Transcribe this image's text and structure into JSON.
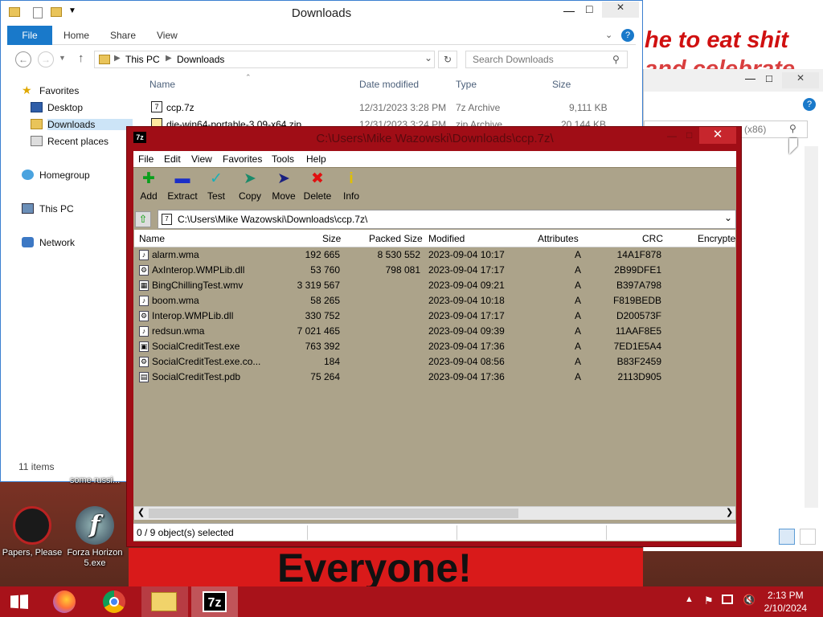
{
  "desktop": {
    "meme_top": [
      "he to eat shit",
      "and celebrate"
    ],
    "meme_bottom": "Everyone!",
    "icons": [
      {
        "label": "some russi..."
      },
      {
        "label": "Papers, Please"
      },
      {
        "label": "Forza Horizon 5.exe"
      }
    ]
  },
  "explorer": {
    "title": "Downloads",
    "tabs": [
      "File",
      "Home",
      "Share",
      "View"
    ],
    "address": [
      "This PC",
      "Downloads"
    ],
    "search_placeholder": "Search Downloads",
    "nav": [
      "Favorites",
      "Desktop",
      "Downloads",
      "Recent places",
      "Homegroup",
      "This PC",
      "Network"
    ],
    "columns": [
      "Name",
      "Date modified",
      "Type",
      "Size"
    ],
    "files": [
      {
        "name": "ccp.7z",
        "date": "12/31/2023 3:28 PM",
        "type": "7z Archive",
        "size": "9,111 KB"
      },
      {
        "name": "die-win64-portable-3.09-x64.zip",
        "date": "12/31/2023 3:24 PM",
        "type": "zip Archive",
        "size": "20,144 KB"
      }
    ],
    "status": "11 items"
  },
  "second_window": {
    "search_hint": "(x86)"
  },
  "sevenzip": {
    "title": "C:\\Users\\Mike Wazowski\\Downloads\\ccp.7z\\",
    "menu": [
      "File",
      "Edit",
      "View",
      "Favorites",
      "Tools",
      "Help"
    ],
    "toolbar": [
      {
        "label": "Add",
        "icon": "plus-icon"
      },
      {
        "label": "Extract",
        "icon": "minus-icon"
      },
      {
        "label": "Test",
        "icon": "check-icon"
      },
      {
        "label": "Copy",
        "icon": "copy-arrow-icon"
      },
      {
        "label": "Move",
        "icon": "move-arrow-icon"
      },
      {
        "label": "Delete",
        "icon": "delete-x-icon"
      },
      {
        "label": "Info",
        "icon": "info-icon"
      }
    ],
    "path": "C:\\Users\\Mike Wazowski\\Downloads\\ccp.7z\\",
    "columns": [
      "Name",
      "Size",
      "Packed Size",
      "Modified",
      "Attributes",
      "CRC",
      "Encrypte"
    ],
    "rows": [
      {
        "name": "alarm.wma",
        "size": "192 665",
        "packed": "8 530 552",
        "modified": "2023-09-04 10:17",
        "attr": "A",
        "crc": "14A1F878",
        "icon": "audio"
      },
      {
        "name": "AxInterop.WMPLib.dll",
        "size": "53 760",
        "packed": "798 081",
        "modified": "2023-09-04 17:17",
        "attr": "A",
        "crc": "2B99DFE1",
        "icon": "dll"
      },
      {
        "name": "BingChillingTest.wmv",
        "size": "3 319 567",
        "packed": "",
        "modified": "2023-09-04 09:21",
        "attr": "A",
        "crc": "B397A798",
        "icon": "video"
      },
      {
        "name": "boom.wma",
        "size": "58 265",
        "packed": "",
        "modified": "2023-09-04 10:18",
        "attr": "A",
        "crc": "F819BEDB",
        "icon": "audio"
      },
      {
        "name": "Interop.WMPLib.dll",
        "size": "330 752",
        "packed": "",
        "modified": "2023-09-04 17:17",
        "attr": "A",
        "crc": "D200573F",
        "icon": "dll"
      },
      {
        "name": "redsun.wma",
        "size": "7 021 465",
        "packed": "",
        "modified": "2023-09-04 09:39",
        "attr": "A",
        "crc": "11AAF8E5",
        "icon": "audio"
      },
      {
        "name": "SocialCreditTest.exe",
        "size": "763 392",
        "packed": "",
        "modified": "2023-09-04 17:36",
        "attr": "A",
        "crc": "7ED1E5A4",
        "icon": "exe"
      },
      {
        "name": "SocialCreditTest.exe.co...",
        "size": "184",
        "packed": "",
        "modified": "2023-09-04 08:56",
        "attr": "A",
        "crc": "B83F2459",
        "icon": "config"
      },
      {
        "name": "SocialCreditTest.pdb",
        "size": "75 264",
        "packed": "",
        "modified": "2023-09-04 17:36",
        "attr": "A",
        "crc": "2113D905",
        "icon": "pdb"
      }
    ],
    "status": "0 / 9 object(s) selected"
  },
  "taskbar": {
    "time": "2:13 PM",
    "date": "2/10/2024",
    "apps": [
      "firefox-icon",
      "chrome-icon",
      "file-explorer-icon",
      "7zip-icon"
    ]
  },
  "colors": {
    "accent": "#1979ca",
    "sevenzip_frame": "#a00d16",
    "sevenzip_body": "#aca38a"
  }
}
